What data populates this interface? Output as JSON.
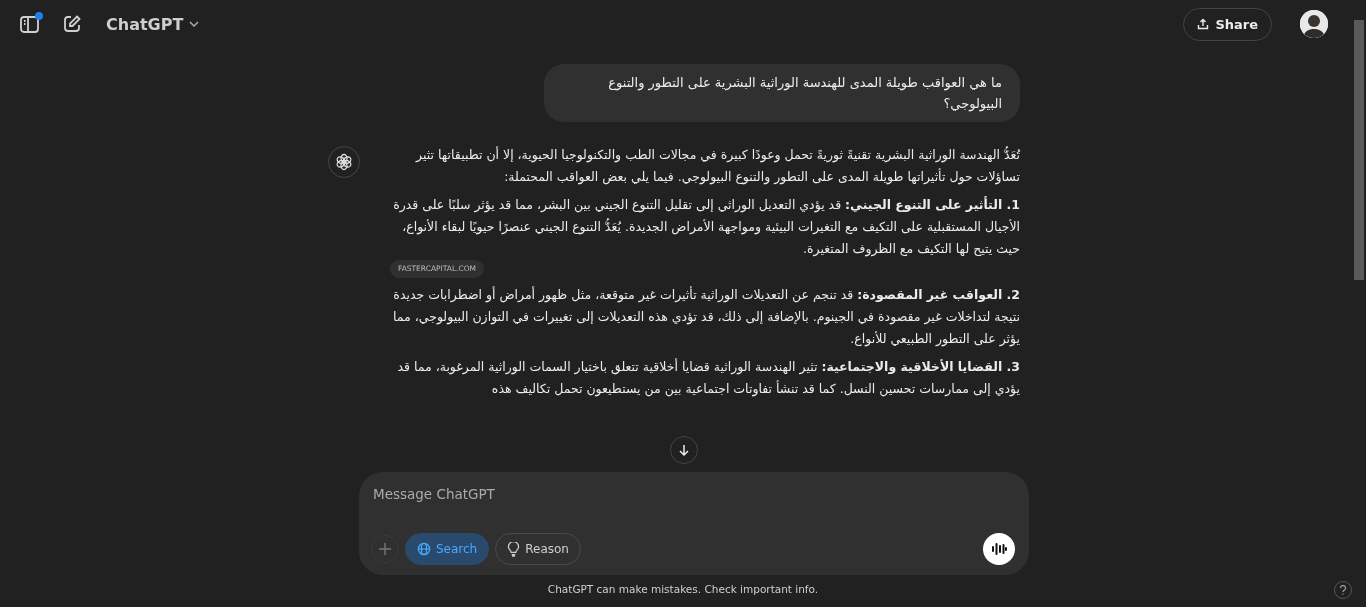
{
  "header": {
    "title": "ChatGPT",
    "sidebar_notification": true,
    "share": "Share"
  },
  "user_message": "ما هي العواقب طويلة المدى للهندسة الوراثية البشرية على التطور والتنوع البيولوجي؟",
  "assistant_paragraphs": [
    {
      "text": "تُعَدُّ الهندسة الوراثية البشرية تقنيةً ثوريةً تحمل وعودًا كبيرة في مجالات الطب والتكنولوجيا الحيوية، إلا أن تطبيقاتها تثير تساؤلات حول تأثيراتها طويلة المدى على التطور والتنوع البيولوجي. فيما يلي بعض العواقب المحتملة:"
    },
    {
      "text": "**1. التأثير على التنوع الجيني:** قد يؤدي التعديل الوراثي إلى تقليل التنوع الجيني بين البشر، مما قد يؤثر سلبًا على قدرة الأجيال المستقبلية على التكيف مع التغيرات البيئية ومواجهة الأمراض الجديدة. يُعَدُّ التنوع الجيني عنصرًا حيويًا لبقاء الأنواع، حيث يتيح لها التكيف مع الظروف المتغيرة.",
      "source": "FASTERCAPITAL.COM"
    },
    {
      "text": "**2. العواقب غير المقصودة:** قد تنجم عن التعديلات الوراثية تأثيرات غير متوقعة، مثل ظهور أمراض أو اضطرابات جديدة نتيجة لتداخلات غير مقصودة في الجينوم. بالإضافة إلى ذلك، قد تؤدي هذه التعديلات إلى تغييرات في التوازن البيولوجي، مما يؤثر على التطور الطبيعي للأنواع."
    },
    {
      "text": "**3. القضايا الأخلاقية والاجتماعية:** تثير الهندسة الوراثية قضايا أخلاقية تتعلق باختيار السمات الوراثية المرغوبة، مما قد يؤدي إلى ممارسات تحسين النسل. كما قد تنشأ تفاوتات اجتماعية بين من يستطيعون تحمل تكاليف هذه"
    }
  ],
  "composer": {
    "placeholder": "Message ChatGPT",
    "search": {
      "label": "Search",
      "selected": true
    },
    "reason": {
      "label": "Reason",
      "selected": false
    }
  },
  "footer": "ChatGPT can make mistakes. Check important info."
}
